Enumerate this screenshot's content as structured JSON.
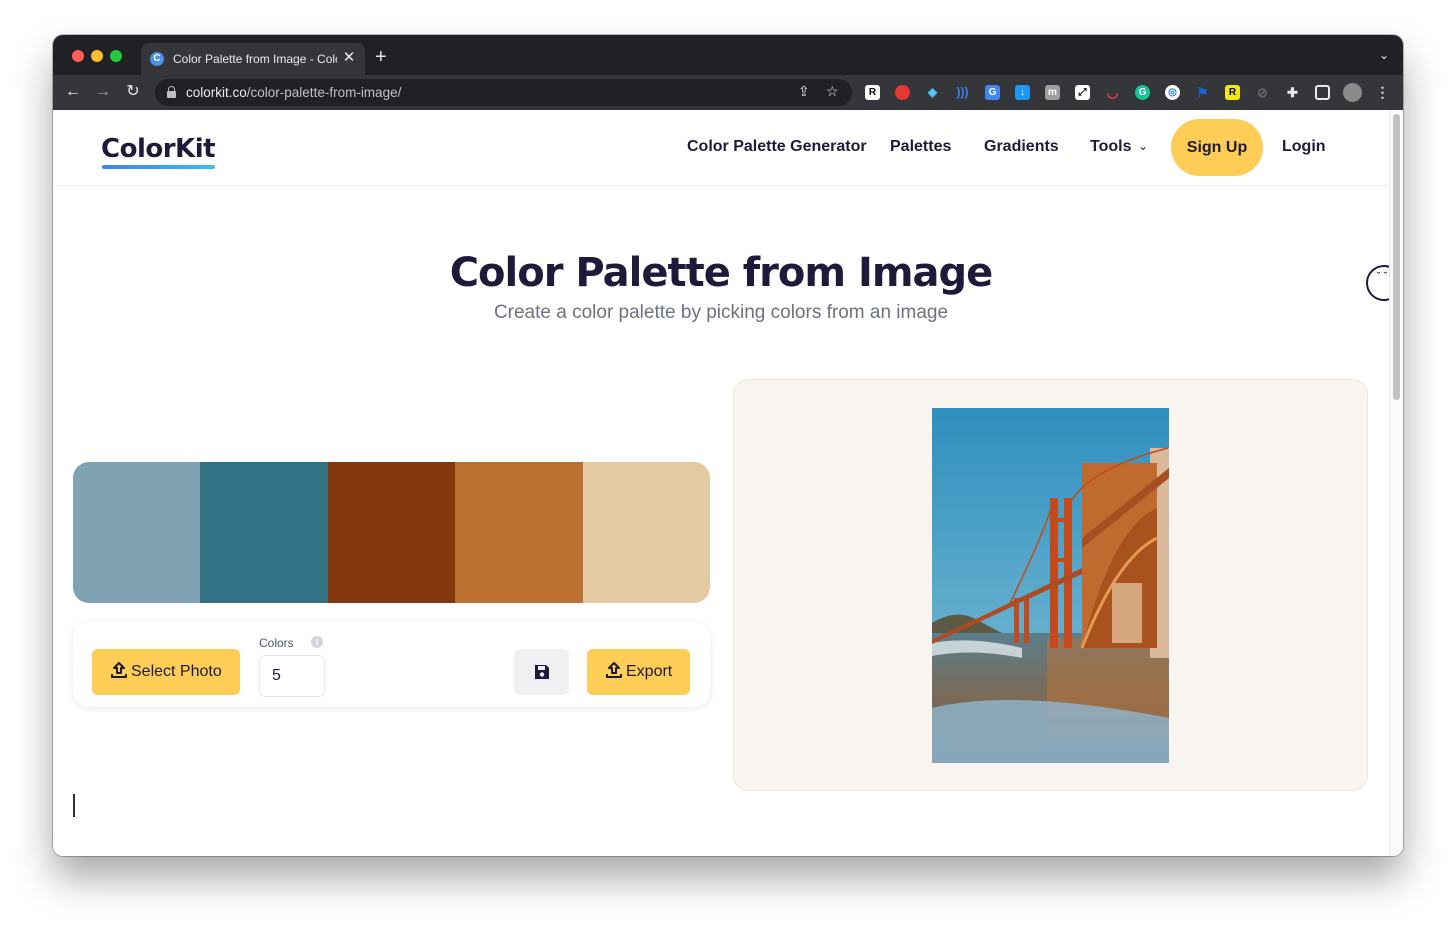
{
  "browser": {
    "tab_title": "Color Palette from Image - Colo",
    "tab_favicon_letter": "C",
    "url_host": "colorkit.co",
    "url_path": "/color-palette-from-image/",
    "extension_icons": [
      "R",
      "pokeball",
      "diamond",
      "wifi",
      "translate",
      "download",
      "m",
      "link",
      "pocket",
      "grammarly",
      "chrome",
      "flag",
      "R",
      "blocked",
      "puzzle",
      "sidebar",
      "avatar"
    ]
  },
  "site": {
    "logo": "ColorKit",
    "nav": {
      "palette_generator": "Color Palette Generator",
      "palettes": "Palettes",
      "gradients": "Gradients",
      "tools": "Tools",
      "signup": "Sign Up",
      "login": "Login"
    }
  },
  "hero": {
    "title": "Color Palette from Image",
    "subtitle": "Create a color palette by picking colors from an image"
  },
  "palette": {
    "swatches": [
      "#7fa3b2",
      "#327284",
      "#83370c",
      "#bb6f31",
      "#e4caa2"
    ]
  },
  "controls": {
    "select_photo_label": "Select Photo",
    "colors_label": "Colors",
    "colors_value": "5",
    "export_label": "Export"
  },
  "colors": {
    "accent_yellow": "#fdcd55",
    "text_dark": "#1e1b3a",
    "chrome_dark": "#202124",
    "panel_bg": "#f8f5f0"
  }
}
